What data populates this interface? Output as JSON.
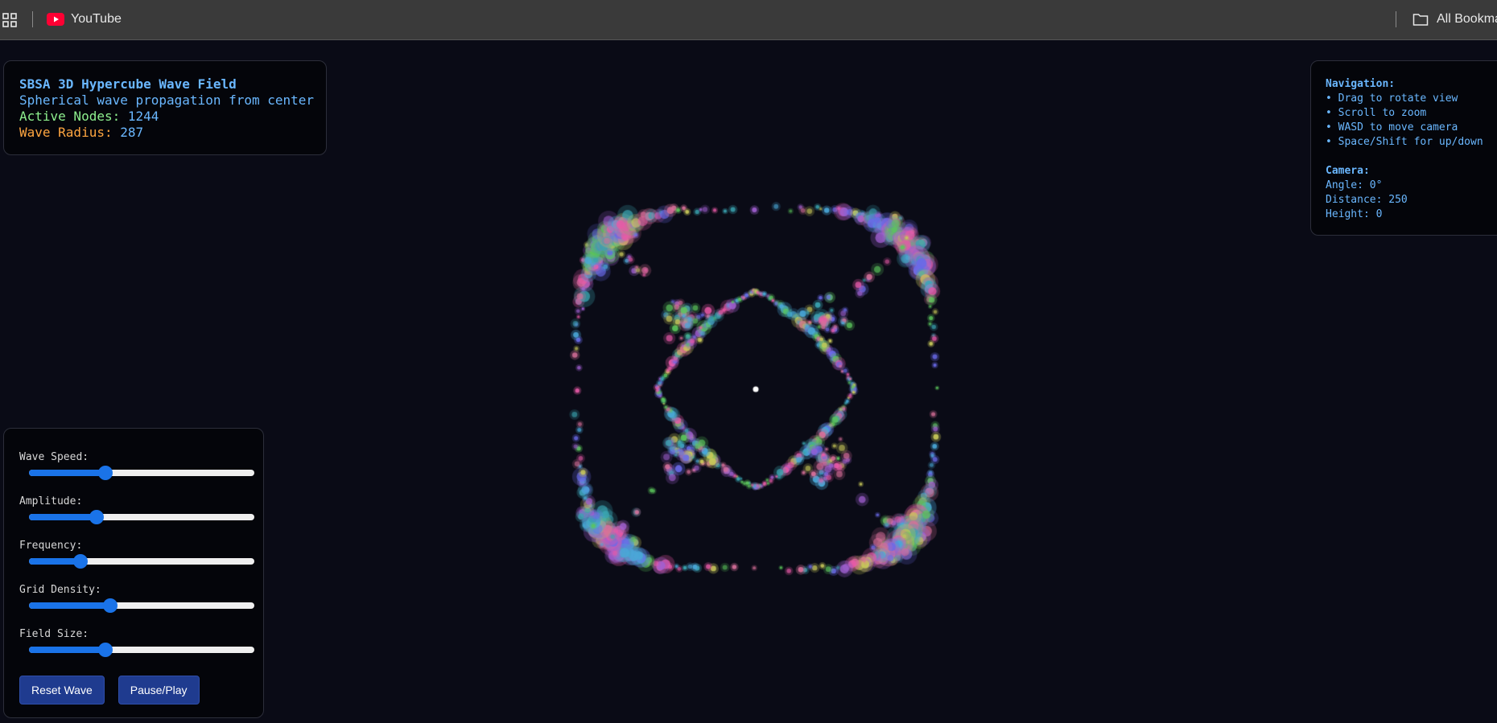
{
  "browser": {
    "bookmarks": [
      {
        "label": "YouTube",
        "icon": "youtube-icon"
      }
    ],
    "all_bookmarks_label": "All Bookmarks"
  },
  "info": {
    "title": "SBSA 3D Hypercube Wave Field",
    "subtitle": "Spherical wave propagation from center",
    "active_nodes_label": "Active Nodes:",
    "active_nodes": "1244",
    "wave_radius_label": "Wave Radius:",
    "wave_radius": "287"
  },
  "navigation": {
    "heading": "Navigation:",
    "items": [
      "• Drag to rotate view",
      "• Scroll to zoom",
      "• WASD to move camera",
      "• Space/Shift for up/down"
    ],
    "camera_heading": "Camera:",
    "angle": "Angle: 0°",
    "distance": "Distance: 250",
    "height": "Height: 0"
  },
  "controls": {
    "sliders": [
      {
        "label": "Wave Speed:",
        "value": 0.34
      },
      {
        "label": "Amplitude:",
        "value": 0.3
      },
      {
        "label": "Frequency:",
        "value": 0.23
      },
      {
        "label": "Grid Density:",
        "value": 0.36
      },
      {
        "label": "Field Size:",
        "value": 0.34
      }
    ],
    "reset_label": "Reset Wave",
    "pause_label": "Pause/Play"
  },
  "colors": {
    "background": "#0a0b16",
    "accent_blue": "#6ab7ff",
    "green": "#8ef08e",
    "orange": "#ffa640",
    "slider_blue": "#1a73e8",
    "button_bg": "#1f3b8f",
    "particle_palette": [
      "#e85aa8",
      "#5cc65c",
      "#6a6ae8",
      "#3aa3b0",
      "#c8c85a",
      "#a060d0",
      "#d8709a",
      "#4aa8d8"
    ]
  }
}
